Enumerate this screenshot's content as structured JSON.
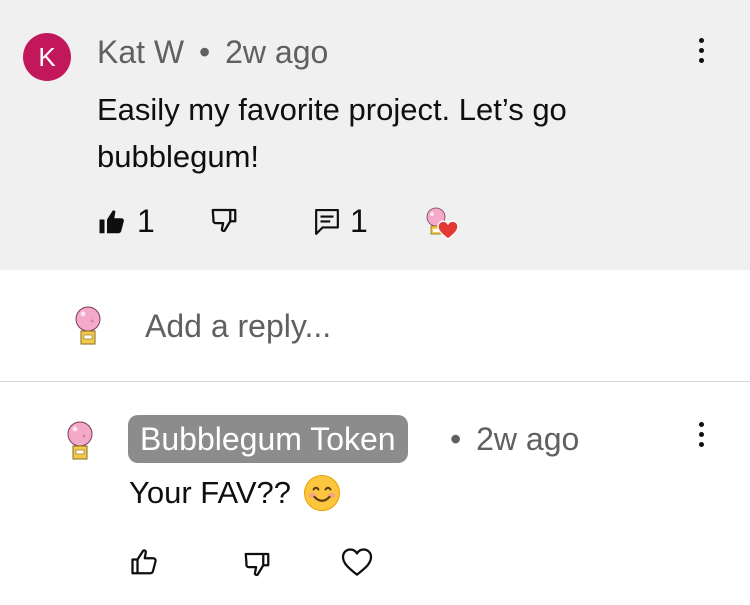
{
  "comment": {
    "avatar_letter": "K",
    "author": "Kat W",
    "separator": "•",
    "time": "2w ago",
    "text": "Easily my favorite project. Let’s go bubblegum!",
    "like_count": "1",
    "reply_count": "1",
    "accent_color": "#c2185b"
  },
  "reply_box": {
    "placeholder": "Add a reply..."
  },
  "reply": {
    "author": "Bubblegum Token",
    "separator": "•",
    "time": "2w ago",
    "text": "Your FAV??",
    "emoji_icon": "smiling-face-emoji-icon"
  }
}
